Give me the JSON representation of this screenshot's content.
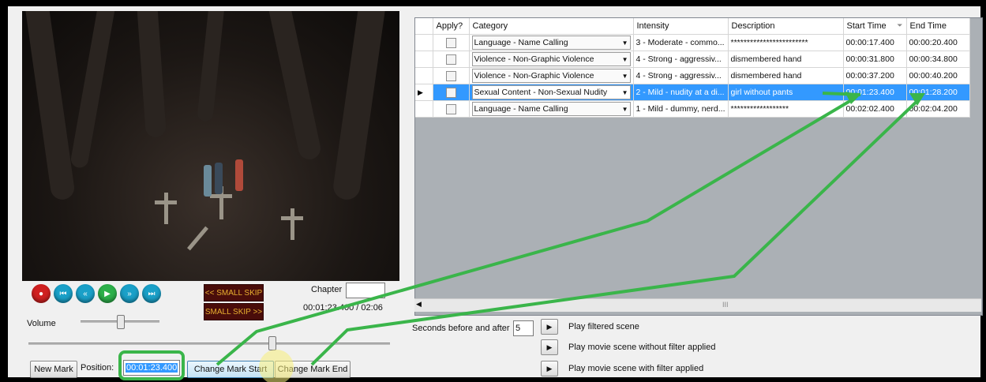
{
  "player": {
    "chapter_label": "Chapter",
    "time_display": "00:01:23.400 / 02:06",
    "volume_label": "Volume",
    "small_skip_back": "<< SMALL SKIP",
    "small_skip_fwd": "SMALL SKIP >>"
  },
  "marks": {
    "new_mark": "New Mark",
    "position_label": "Position:",
    "position_value": "00:01:23.400",
    "change_start": "Change Mark Start",
    "change_end": "Change Mark End"
  },
  "grid": {
    "columns": [
      "Apply?",
      "Category",
      "Intensity",
      "Description",
      "Start Time",
      "End Time"
    ],
    "rows": [
      {
        "category": "Language - Name Calling",
        "intensity": "3 - Moderate - commo...",
        "description": "************************",
        "start": "00:00:17.400",
        "end": "00:00:20.400"
      },
      {
        "category": "Violence - Non-Graphic Violence",
        "intensity": "4 - Strong - aggressiv...",
        "description": "dismembered hand",
        "start": "00:00:31.800",
        "end": "00:00:34.800"
      },
      {
        "category": "Violence - Non-Graphic Violence",
        "intensity": "4 - Strong - aggressiv...",
        "description": "dismembered hand",
        "start": "00:00:37.200",
        "end": "00:00:40.200"
      },
      {
        "category": "Sexual Content - Non-Sexual Nudity",
        "intensity": "2 - Mild - nudity at a di...",
        "description": "girl without pants",
        "start": "00:01:23.400",
        "end": "00:01:28.200"
      },
      {
        "category": "Language - Name Calling",
        "intensity": "1 - Mild - dummy, nerd...",
        "description": "******************",
        "start": "00:02:02.400",
        "end": "00:02:04.200"
      }
    ],
    "scroll_label": "III"
  },
  "playback": {
    "seconds_label": "Seconds before and after",
    "seconds_value": "5",
    "play_filtered": "Play filtered scene",
    "play_without": "Play movie scene without filter applied",
    "play_with": "Play movie scene with filter applied"
  },
  "colors": {
    "annotation": "#3ab54a",
    "selection": "#3399ff"
  }
}
